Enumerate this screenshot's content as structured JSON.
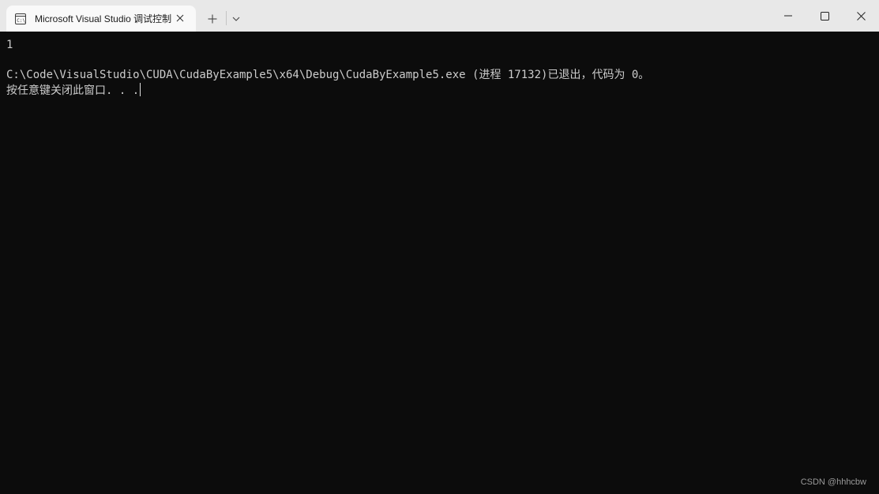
{
  "tab": {
    "title": "Microsoft Visual Studio 调试控制台",
    "icon": "console-icon",
    "close_icon": "close-icon"
  },
  "titlebar": {
    "new_tab_icon": "plus-icon",
    "dropdown_icon": "chevron-down-icon",
    "minimize_icon": "minimize-icon",
    "maximize_icon": "maximize-icon",
    "close_icon": "close-icon"
  },
  "console": {
    "lines": [
      "1",
      "",
      "C:\\Code\\VisualStudio\\CUDA\\CudaByExample5\\x64\\Debug\\CudaByExample5.exe (进程 17132)已退出，代码为 0。",
      "按任意键关闭此窗口. . ."
    ],
    "text_color": "#cccccc",
    "background": "#0c0c0c"
  },
  "watermark": "CSDN @hhhcbw"
}
